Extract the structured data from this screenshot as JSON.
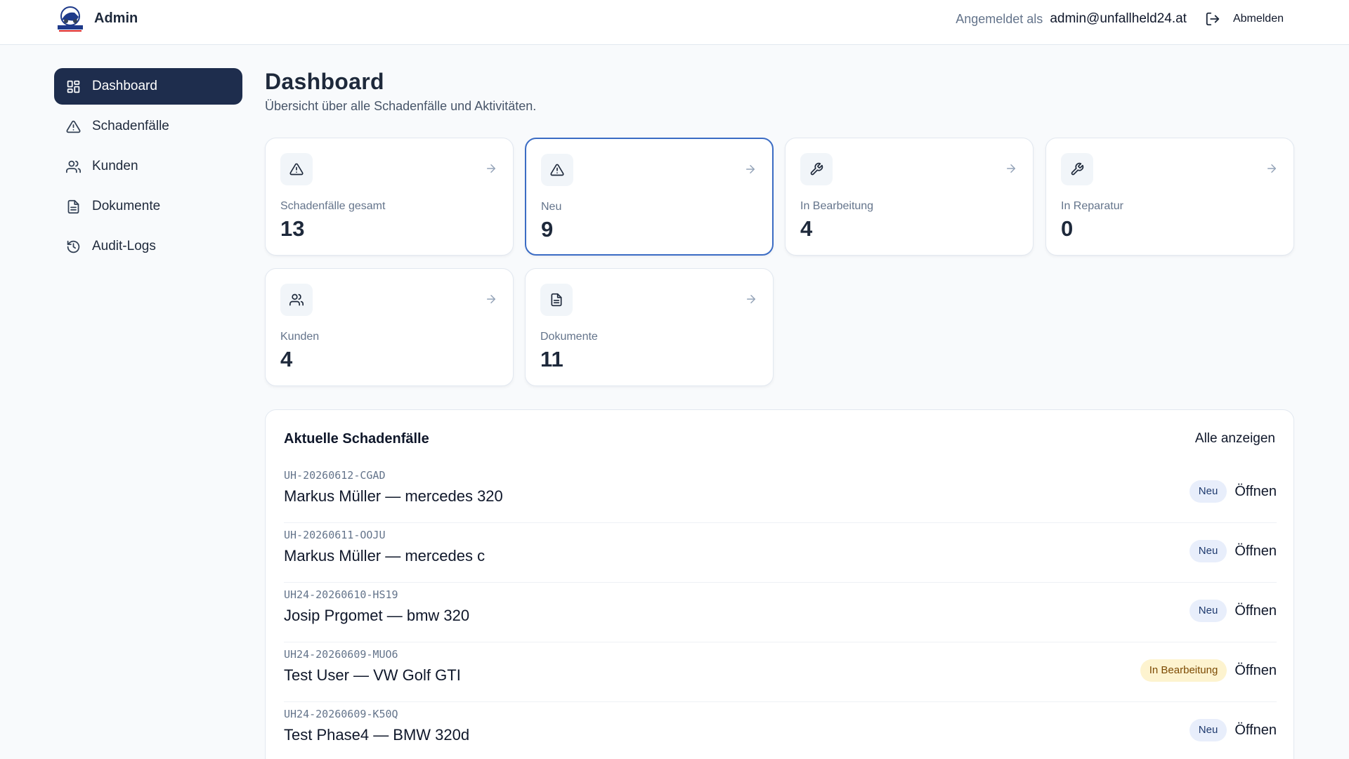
{
  "header": {
    "brand": "Admin",
    "logged_in_label": "Angemeldet als",
    "user_email": "admin@unfallheld24.at",
    "logout_label": "Abmelden"
  },
  "sidebar": {
    "items": [
      {
        "label": "Dashboard",
        "icon": "dashboard-icon",
        "active": true
      },
      {
        "label": "Schadenfälle",
        "icon": "warning-icon"
      },
      {
        "label": "Kunden",
        "icon": "users-icon"
      },
      {
        "label": "Dokumente",
        "icon": "document-icon"
      },
      {
        "label": "Audit-Logs",
        "icon": "history-icon"
      }
    ]
  },
  "page": {
    "title": "Dashboard",
    "subtitle": "Übersicht über alle Schadenfälle und Aktivitäten."
  },
  "stats": [
    {
      "label": "Schadenfälle gesamt",
      "value": "13",
      "icon": "warning-icon"
    },
    {
      "label": "Neu",
      "value": "9",
      "icon": "warning-icon"
    },
    {
      "label": "In Bearbeitung",
      "value": "4",
      "icon": "wrench-icon"
    },
    {
      "label": "In Reparatur",
      "value": "0",
      "icon": "wrench-icon"
    },
    {
      "label": "Kunden",
      "value": "4",
      "icon": "users-icon"
    },
    {
      "label": "Dokumente",
      "value": "11",
      "icon": "document-icon"
    }
  ],
  "recent": {
    "title": "Aktuelle Schadenfälle",
    "show_all_label": "Alle anzeigen",
    "open_label": "Öffnen",
    "cases": [
      {
        "id": "UH-20260612-CGAD",
        "name": "Markus Müller — mercedes 320",
        "status": "Neu"
      },
      {
        "id": "UH-20260611-OOJU",
        "name": "Markus Müller — mercedes c",
        "status": "Neu"
      },
      {
        "id": "UH24-20260610-HS19",
        "name": "Josip Prgomet — bmw 320",
        "status": "Neu"
      },
      {
        "id": "UH24-20260609-MUO6",
        "name": "Test User — VW Golf GTI",
        "status": "In Bearbeitung"
      },
      {
        "id": "UH24-20260609-K50Q",
        "name": "Test Phase4 — BMW 320d",
        "status": "Neu"
      }
    ]
  },
  "colors": {
    "accent": "#1e2d4d",
    "highlight_border": "#3b6cc4",
    "badge_new_bg": "#e8eefb",
    "badge_progress_bg": "#fdf3cf"
  }
}
